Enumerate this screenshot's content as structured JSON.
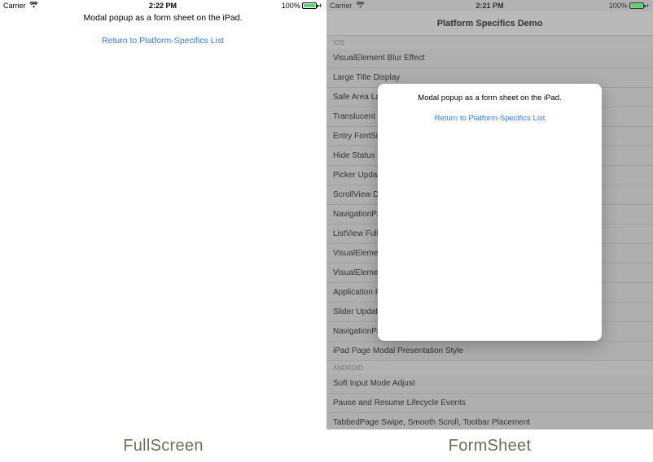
{
  "statusbar": {
    "carrier": "Carrier",
    "wifi": "▲",
    "time_left": "2:22 PM",
    "time_right": "2:21 PM",
    "battery_pct": "100%",
    "charging": "+"
  },
  "modal": {
    "message": "Modal popup as a form sheet on the iPad.",
    "link": "Return to Platform-Specifics List"
  },
  "right_pane": {
    "nav_title": "Platform Specifics Demo",
    "sections": {
      "ios": {
        "header": "IOS",
        "items": [
          "VisualElement Blur Effect",
          "Large Title Display",
          "Safe Area Layout Guide",
          "Translucent Navigation Bar",
          "Entry FontSize",
          "Hide Status Bar",
          "Picker UpdateMode",
          "ScrollView DelayContentTouches",
          "NavigationPage Transitions",
          "ListView FullWidth Separator",
          "VisualElement Shadow",
          "VisualElement Elevation",
          "Application PrefersStatusBarHidden",
          "Slider UpdateOnTap",
          "NavigationPage HasLegacy",
          "iPad Page Modal Presentation Style"
        ]
      },
      "android": {
        "header": "ANDROID",
        "items": [
          "Soft Input Mode Adjust",
          "Pause and Resume Lifecycle Events",
          "TabbedPage Swipe, Smooth Scroll, Toolbar Placement"
        ]
      }
    }
  },
  "captions": {
    "left": "FullScreen",
    "right": "FormSheet"
  },
  "icons": {
    "wifi_svg": true
  }
}
